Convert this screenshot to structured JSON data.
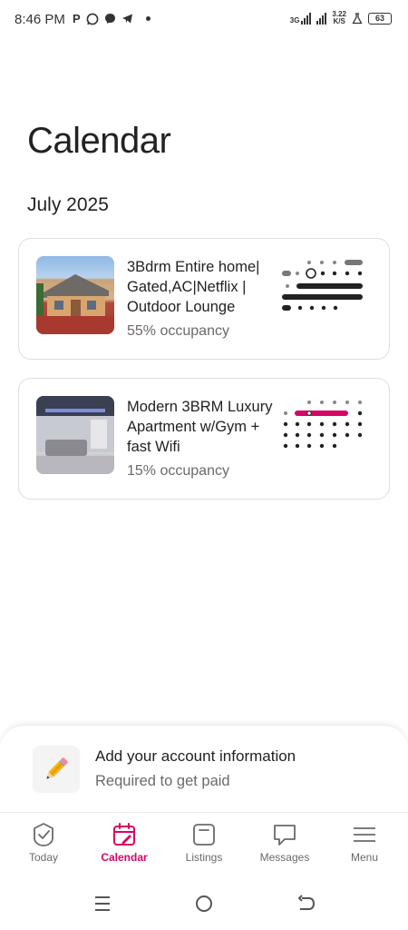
{
  "status_bar": {
    "time": "8:46 PM",
    "apps": [
      "P",
      "whatsapp-icon",
      "messenger-icon",
      "telegram-icon"
    ],
    "network": "3G",
    "speed_value": "3.22",
    "speed_unit": "K/S",
    "battery": "63"
  },
  "page": {
    "title": "Calendar",
    "month": "July 2025"
  },
  "listings": [
    {
      "title": "3Bdrm Entire home| Gated,AC|Netflix | Outdoor Lounge",
      "occupancy": "55% occupancy"
    },
    {
      "title": "Modern 3BRM Luxury Apartment w/Gym + fast Wifi",
      "occupancy": "15% occupancy"
    }
  ],
  "account_banner": {
    "title": "Add your account information",
    "subtitle": "Required to get paid",
    "icon": "pencil-icon"
  },
  "bottom_nav": {
    "items": [
      {
        "label": "Today",
        "icon": "today-check-icon",
        "active": false
      },
      {
        "label": "Calendar",
        "icon": "calendar-icon",
        "active": true
      },
      {
        "label": "Listings",
        "icon": "listings-icon",
        "active": false
      },
      {
        "label": "Messages",
        "icon": "messages-icon",
        "active": false
      },
      {
        "label": "Menu",
        "icon": "menu-icon",
        "active": false
      }
    ]
  },
  "colors": {
    "accent": "#d70466",
    "text_primary": "#222222",
    "text_secondary": "#6a6a6a",
    "card_border": "#dddddd"
  }
}
